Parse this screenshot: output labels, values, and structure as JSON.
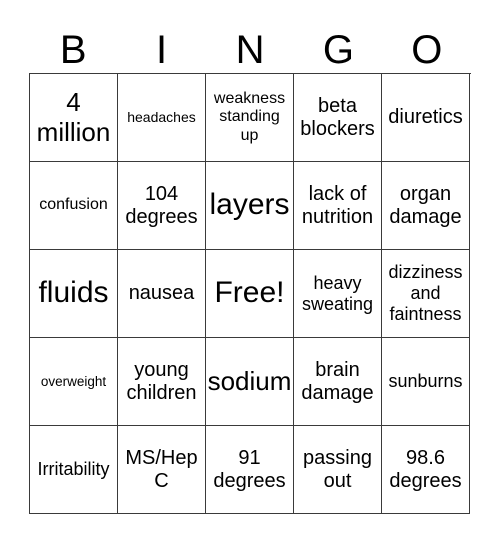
{
  "card": {
    "header": [
      "B",
      "I",
      "N",
      "G",
      "O"
    ],
    "rows": [
      [
        {
          "text": "4\nmillion",
          "size": "lg"
        },
        {
          "text": "headaches",
          "size": "xxs"
        },
        {
          "text": "weakness\nstanding\nup",
          "size": "xs"
        },
        {
          "text": "beta\nblockers",
          "size": "md"
        },
        {
          "text": "diuretics",
          "size": "md"
        }
      ],
      [
        {
          "text": "confusion",
          "size": "xs"
        },
        {
          "text": "104\ndegrees",
          "size": "md"
        },
        {
          "text": "layers",
          "size": "xl"
        },
        {
          "text": "lack of\nnutrition",
          "size": "md"
        },
        {
          "text": "organ\ndamage",
          "size": "md"
        }
      ],
      [
        {
          "text": "fluids",
          "size": "xl"
        },
        {
          "text": "nausea",
          "size": "md"
        },
        {
          "text": "Free!",
          "size": "xl"
        },
        {
          "text": "heavy\nsweating",
          "size": "sm"
        },
        {
          "text": "dizziness\nand\nfaintness",
          "size": "sm"
        }
      ],
      [
        {
          "text": "overweight",
          "size": "tiny"
        },
        {
          "text": "young\nchildren",
          "size": "md"
        },
        {
          "text": "sodium",
          "size": "lg"
        },
        {
          "text": "brain\ndamage",
          "size": "md"
        },
        {
          "text": "sunburns",
          "size": "sm"
        }
      ],
      [
        {
          "text": "Irritability",
          "size": "sm"
        },
        {
          "text": "MS/Hep\nC",
          "size": "md"
        },
        {
          "text": "91\ndegrees",
          "size": "md"
        },
        {
          "text": "passing\nout",
          "size": "md"
        },
        {
          "text": "98.6\ndegrees",
          "size": "md"
        }
      ]
    ]
  },
  "colors": {
    "border": "#3a3a3a",
    "text": "#000000",
    "background": "#ffffff"
  }
}
